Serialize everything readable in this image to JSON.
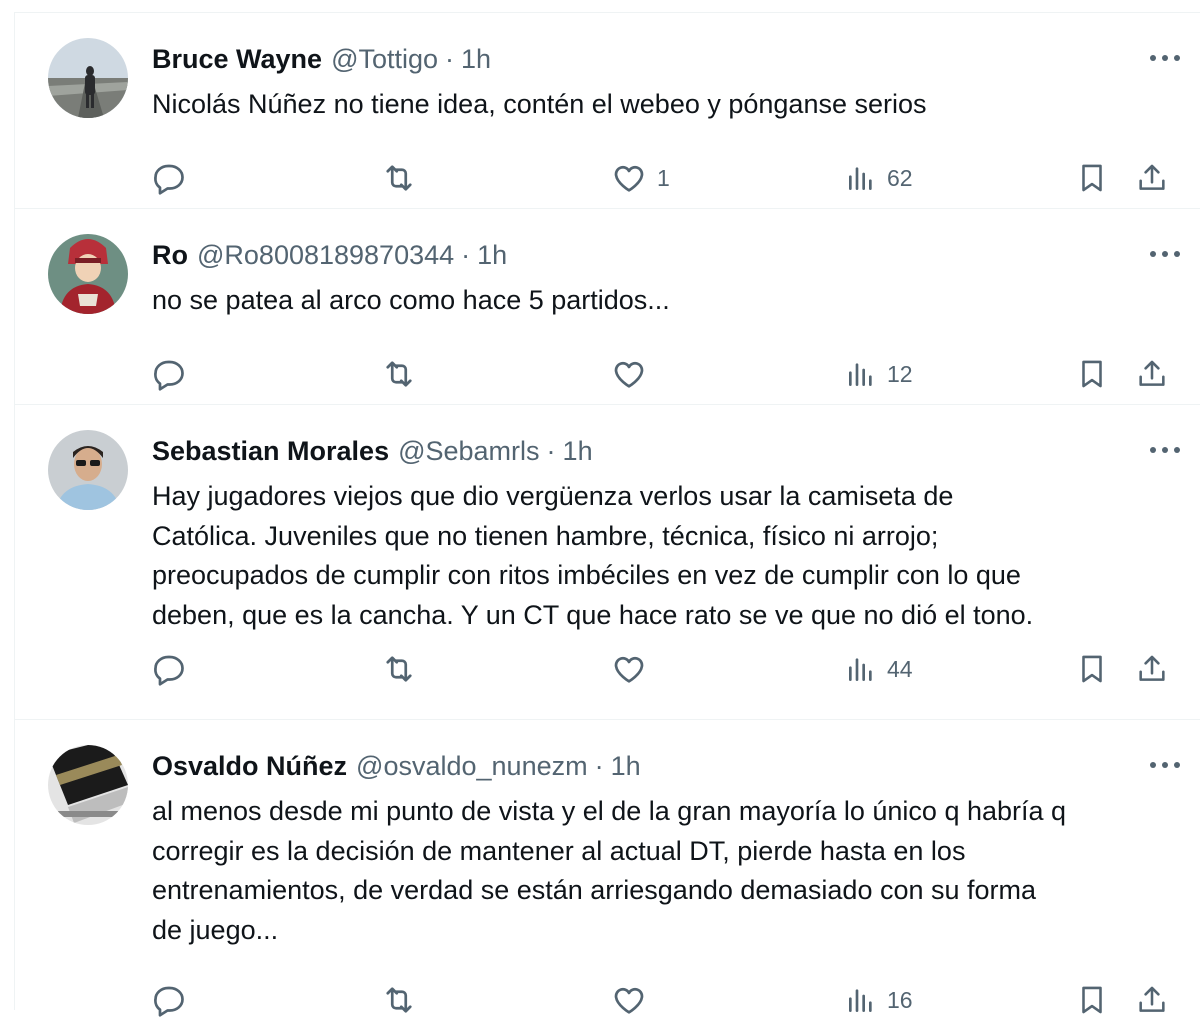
{
  "tweets": [
    {
      "name": "Bruce Wayne",
      "handle": "@Tottigo",
      "separator": "·",
      "time": "1h",
      "lines": [
        "Nicolás Núñez no tiene idea, contén el webeo y pónganse serios"
      ],
      "likes": "1",
      "views": "62",
      "avatar_colors": [
        "#d3dde6",
        "#6b6f6c",
        "#2a2b2e"
      ]
    },
    {
      "name": "Ro",
      "handle": "@Ro8008189870344",
      "separator": "·",
      "time": "1h",
      "lines": [
        "no se patea al arco como hace 5 partidos..."
      ],
      "likes": "",
      "views": "12",
      "avatar_colors": [
        "#6e8f83",
        "#b8303a",
        "#f0d2b6"
      ]
    },
    {
      "name": "Sebastian Morales",
      "handle": "@Sebamrls",
      "separator": "·",
      "time": "1h",
      "lines": [
        "Hay jugadores viejos que dio vergüenza verlos usar la camiseta de",
        "Católica. Juveniles que no tienen hambre, técnica, físico ni arrojo;",
        "preocupados de cumplir con ritos imbéciles en vez de cumplir con lo que",
        "deben, que es la cancha. Y un CT que hace rato se ve que no dió el tono."
      ],
      "likes": "",
      "views": "44",
      "avatar_colors": [
        "#c9ced2",
        "#2b2420",
        "#d6ad8d"
      ]
    },
    {
      "name": "Osvaldo Núñez",
      "handle": "@osvaldo_nunezm",
      "separator": "·",
      "time": "1h",
      "lines": [
        "al menos desde mi punto de vista y el de la gran mayoría lo único q habría q",
        "corregir es la decisión de mantener al actual DT, pierde hasta en los",
        "entrenamientos, de verdad se están arriesgando demasiado con su forma",
        "de juego..."
      ],
      "likes": "",
      "views": "16",
      "avatar_colors": [
        "#e4e4e4",
        "#1b1b1b",
        "#9a8a5a"
      ]
    }
  ],
  "icons": {
    "reply": "reply-icon",
    "retweet": "retweet-icon",
    "like": "like-icon",
    "views": "views-icon",
    "bookmark": "bookmark-icon",
    "share": "share-icon",
    "more": "more-icon"
  },
  "colors": {
    "text": "#0f1419",
    "secondary": "#536471",
    "border": "#eff3f4"
  }
}
